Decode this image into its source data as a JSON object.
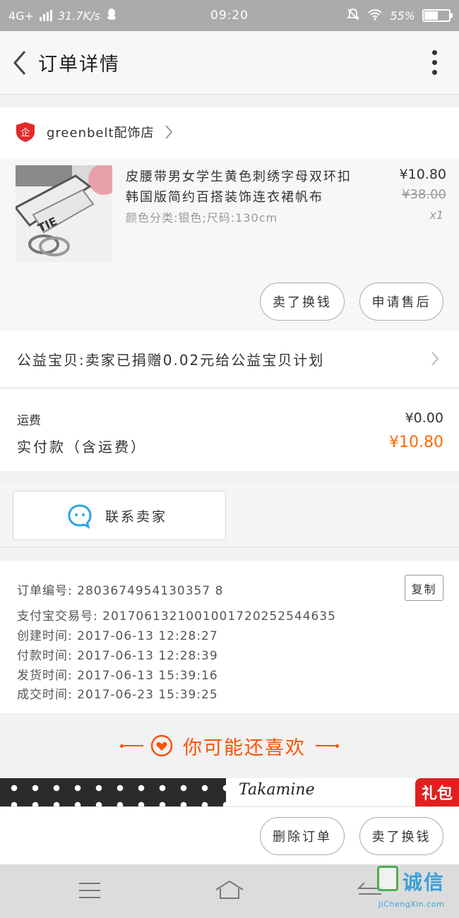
{
  "status_bar": {
    "network": "4G+",
    "speed": "31.7K/s",
    "time": "09:20",
    "battery": "55%",
    "battery_level": 0.55
  },
  "header": {
    "title": "订单详情"
  },
  "shop": {
    "name": "greenbelt配饰店",
    "logo_text": "企"
  },
  "item": {
    "title": "皮腰带男女学生黄色刺绣字母双环扣韩国版简约百搭装饰连衣裙帆布",
    "sku": "颜色分类:银色;尺码:130cm",
    "price_now": "¥10.80",
    "price_old": "¥38.00",
    "quantity": "x1",
    "image_text": "TIE"
  },
  "item_actions": {
    "sold_swap": "卖了换钱",
    "after_sale": "申请售后"
  },
  "charity": {
    "text": "公益宝贝:卖家已捐赠0.02元给公益宝贝计划"
  },
  "payment": {
    "shipping_label": "运费",
    "shipping_value": "¥0.00",
    "paid_label": "实付款（含运费）",
    "paid_value": "¥10.80"
  },
  "contact": {
    "label": "联系卖家"
  },
  "order_info": {
    "order_no": "订单编号: 2803674954130357 8",
    "alipay_no": "支付宝交易号: 2017061321001001720252544635",
    "created": "创建时间: 2017-06-13 12:28:27",
    "paid": "付款时间: 2017-06-13 12:28:39",
    "shipped": "发货时间: 2017-06-13 15:39:16",
    "completed": "成交时间: 2017-06-23 15:39:25",
    "copy_label": "复制"
  },
  "recommend": {
    "title": "你可能还喜欢"
  },
  "banner": {
    "brand": "Takamine",
    "gift": "礼包"
  },
  "bottom_actions": {
    "delete": "删除订单",
    "sold_swap": "卖了换钱"
  },
  "watermark": {
    "text": "诚信",
    "url": "JiChengXin.com"
  },
  "colors": {
    "accent": "#ff5000",
    "price_accent": "#ff6a00",
    "chat_icon": "#2fa3e6",
    "shop_logo": "#e02a2a"
  }
}
